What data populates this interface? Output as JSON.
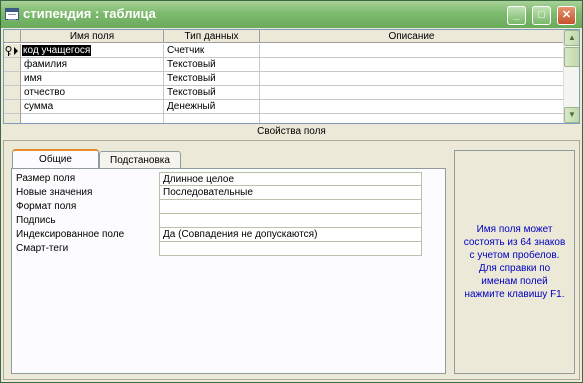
{
  "window": {
    "title": "стипендия : таблица",
    "buttons": {
      "minimize": "_",
      "maximize": "□",
      "close": "✕"
    }
  },
  "grid": {
    "columns": [
      "Имя поля",
      "Тип данных",
      "Описание"
    ],
    "rows": [
      {
        "name": "код учащегося",
        "type": "Счетчик",
        "description": "",
        "primary_key": true,
        "selected": true
      },
      {
        "name": "фамилия",
        "type": "Текстовый",
        "description": ""
      },
      {
        "name": "имя",
        "type": "Текстовый",
        "description": ""
      },
      {
        "name": "отчество",
        "type": "Текстовый",
        "description": ""
      },
      {
        "name": "сумма",
        "type": "Денежный",
        "description": ""
      },
      {
        "name": "",
        "type": "",
        "description": ""
      }
    ],
    "icons": {
      "key": "key-icon",
      "row_pointer": "row-pointer-icon"
    }
  },
  "properties": {
    "section_label": "Свойства поля",
    "tabs": [
      "Общие",
      "Подстановка"
    ],
    "active_tab": "Общие",
    "rows": [
      {
        "label": "Размер поля",
        "value": "Длинное целое"
      },
      {
        "label": "Новые значения",
        "value": "Последовательные"
      },
      {
        "label": "Формат поля",
        "value": ""
      },
      {
        "label": "Подпись",
        "value": ""
      },
      {
        "label": "Индексированное поле",
        "value": "Да (Совпадения не допускаются)"
      },
      {
        "label": "Смарт-теги",
        "value": ""
      }
    ],
    "help_text": "Имя поля может состоять из 64 знаков с учетом пробелов.  Для справки по именам полей нажмите клавишу F1."
  },
  "colors": {
    "titlebar": "#7DBB6E",
    "help_text": "#0000C0",
    "active_tab_accent": "#E68B2C"
  }
}
